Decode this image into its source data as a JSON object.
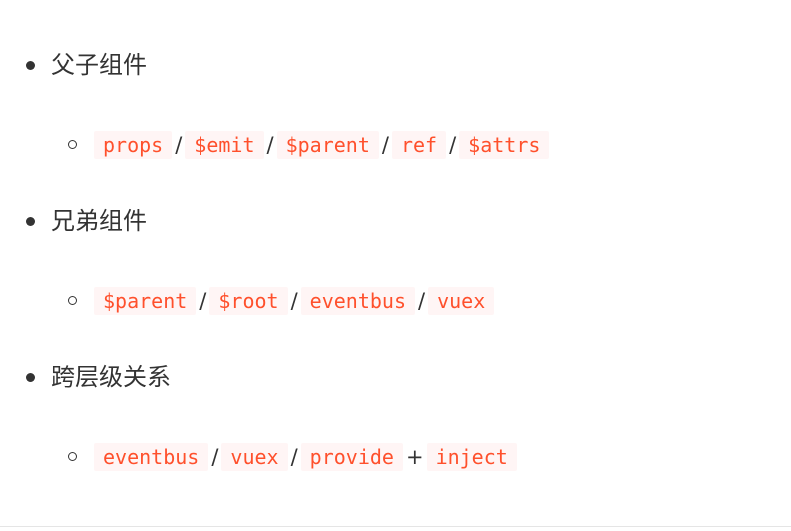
{
  "sections": [
    {
      "heading": "父子组件",
      "items": [
        "props",
        "$emit",
        "$parent",
        "ref",
        "$attrs"
      ],
      "separators": [
        "/",
        "/",
        "/",
        "/"
      ]
    },
    {
      "heading": "兄弟组件",
      "items": [
        "$parent",
        "$root",
        "eventbus",
        "vuex"
      ],
      "separators": [
        "/",
        "/",
        "/"
      ]
    },
    {
      "heading": "跨层级关系",
      "items": [
        "eventbus",
        "vuex",
        "provide",
        "inject"
      ],
      "separators": [
        "/",
        "/",
        "+"
      ]
    }
  ],
  "colors": {
    "text": "#333333",
    "code_text": "#ff502c",
    "code_background": "#fff5f5",
    "divider": "#e5e5e5"
  }
}
